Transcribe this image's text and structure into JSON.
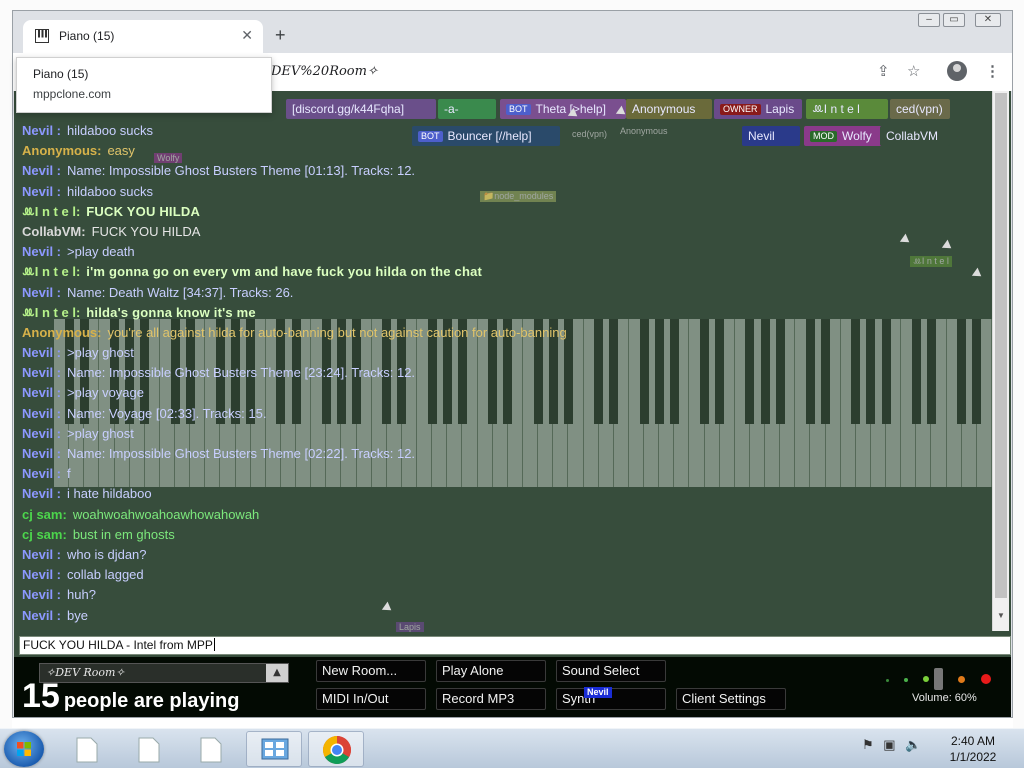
{
  "browser": {
    "tab_title": "Piano (15)",
    "tab_close": "✕",
    "new_tab": "+",
    "url_text": "DEV%20Room✧",
    "tooltip_title": "Piano (15)",
    "tooltip_url": "mppclone.com"
  },
  "userbar": [
    {
      "tag": "",
      "tag_color": "",
      "name": "[discord.gg/k44Fqha]",
      "color": "#6a4f8a"
    },
    {
      "tag": "",
      "tag_color": "",
      "name": "-a-",
      "color": "#3a8a4d"
    },
    {
      "tag": "BOT",
      "tag_color": "#4d5fcc",
      "name": "Theta [>help]",
      "color": "#7a4f8f"
    },
    {
      "tag": "",
      "tag_color": "",
      "name": "Anonymous",
      "color": "#6a6a3a"
    },
    {
      "tag": "OWNER",
      "tag_color": "#8a1a1a",
      "name": "Lapis",
      "color": "#6a4a8a"
    },
    {
      "tag": "",
      "tag_color": "",
      "name": "ꔛI n t e l",
      "color": "#5a8a3a"
    },
    {
      "tag": "",
      "tag_color": "",
      "name": "ced(vpn)",
      "color": "#6a6a4a"
    },
    {
      "tag": "BOT",
      "tag_color": "#4d5fcc",
      "name": "Bouncer [//help]",
      "color": "#2a4a6a"
    },
    {
      "tag": "",
      "tag_color": "",
      "name": "Nevil",
      "color": "#2a3a8a"
    },
    {
      "tag": "MOD",
      "tag_color": "#2a6a2a",
      "name": "Wolfy",
      "color": "#8a3a8a"
    },
    {
      "tag": "",
      "tag_color": "",
      "name": "CollabVM",
      "color": "#374d3c"
    }
  ],
  "chat": [
    {
      "name": "Nevil :",
      "text": "hildaboo sucks",
      "ncolor": "#8c98ff",
      "tcolor": "#c8cfff"
    },
    {
      "name": "Anonymous:",
      "text": "easy",
      "ncolor": "#d7b24a",
      "tcolor": "#e0c46a"
    },
    {
      "name": "Nevil :",
      "text": "Name: Impossible Ghost Busters Theme [01:13]. Tracks: 12.",
      "ncolor": "#8c98ff",
      "tcolor": "#c8cfff"
    },
    {
      "name": "Nevil :",
      "text": "hildaboo sucks",
      "ncolor": "#8c98ff",
      "tcolor": "#c8cfff"
    },
    {
      "name": "ꔛI n t e l:",
      "text": "FUCK YOU HILDA",
      "ncolor": "#b6f28a",
      "tcolor": "#dbffc0"
    },
    {
      "name": "CollabVM:",
      "text": "FUCK YOU HILDA",
      "ncolor": "#d9d9d9",
      "tcolor": "#e6e6e6"
    },
    {
      "name": "Nevil :",
      "text": ">play death",
      "ncolor": "#8c98ff",
      "tcolor": "#c8cfff"
    },
    {
      "name": "ꔛI n t e l:",
      "text": "i'm gonna go on every vm and have fuck you hilda on the chat",
      "ncolor": "#b6f28a",
      "tcolor": "#dbffc0"
    },
    {
      "name": "Nevil :",
      "text": "Name: Death Waltz [34:37]. Tracks: 26.",
      "ncolor": "#8c98ff",
      "tcolor": "#c8cfff"
    },
    {
      "name": "ꔛI n t e l:",
      "text": "hilda's gonna know it's me",
      "ncolor": "#b6f28a",
      "tcolor": "#dbffc0"
    },
    {
      "name": "Anonymous:",
      "text": "you're all against hilda for auto-banning but not against caution for auto-banning",
      "ncolor": "#d7b24a",
      "tcolor": "#e0c46a"
    },
    {
      "name": "Nevil :",
      "text": ">play ghost",
      "ncolor": "#8c98ff",
      "tcolor": "#c8cfff"
    },
    {
      "name": "Nevil :",
      "text": "Name: Impossible Ghost Busters Theme [23:24]. Tracks: 12.",
      "ncolor": "#8c98ff",
      "tcolor": "#c8cfff"
    },
    {
      "name": "Nevil :",
      "text": ">play voyage",
      "ncolor": "#8c98ff",
      "tcolor": "#c8cfff"
    },
    {
      "name": "Nevil :",
      "text": "Name: Voyage [02:33]. Tracks: 15.",
      "ncolor": "#8c98ff",
      "tcolor": "#c8cfff"
    },
    {
      "name": "Nevil :",
      "text": ">play ghost",
      "ncolor": "#8c98ff",
      "tcolor": "#c8cfff"
    },
    {
      "name": "Nevil :",
      "text": "Name: Impossible Ghost Busters Theme [02:22]. Tracks: 12.",
      "ncolor": "#8c98ff",
      "tcolor": "#c8cfff"
    },
    {
      "name": "Nevil :",
      "text": "f",
      "ncolor": "#8c98ff",
      "tcolor": "#c8cfff"
    },
    {
      "name": "Nevil :",
      "text": "i hate hildaboo",
      "ncolor": "#8c98ff",
      "tcolor": "#c8cfff"
    },
    {
      "name": "cj sam:",
      "text": "woahwoahwoahoawhowahowah",
      "ncolor": "#4cd64c",
      "tcolor": "#7ce87c"
    },
    {
      "name": "cj sam:",
      "text": "bust in em ghosts",
      "ncolor": "#4cd64c",
      "tcolor": "#7ce87c"
    },
    {
      "name": "Nevil :",
      "text": "who is djdan?",
      "ncolor": "#8c98ff",
      "tcolor": "#c8cfff"
    },
    {
      "name": "Nevil :",
      "text": "collab lagged",
      "ncolor": "#8c98ff",
      "tcolor": "#c8cfff"
    },
    {
      "name": "Nevil :",
      "text": "huh?",
      "ncolor": "#8c98ff",
      "tcolor": "#c8cfff"
    },
    {
      "name": "Nevil :",
      "text": "bye",
      "ncolor": "#8c98ff",
      "tcolor": "#c8cfff"
    }
  ],
  "input_value": "FUCK YOU HILDA - Intel from MPP",
  "room": {
    "name": "✧DEV Room✧",
    "arrow": "▲",
    "count": "15",
    "count_label": "people are playing"
  },
  "buttons": {
    "new_room": "New Room...",
    "play_alone": "Play Alone",
    "sound_select": "Sound Select",
    "midi": "MIDI In/Out",
    "record": "Record MP3",
    "synth": "Synth",
    "client_settings": "Client Settings"
  },
  "volume": {
    "label": "Volume: 60%",
    "level": 0.6
  },
  "cursor_tag": "Nevil",
  "cursor_labels": {
    "lapis": "Lapis",
    "node_modules": "📁node_modules",
    "ced": "ced(vpn)",
    "anon": "Anonymous",
    "intel": "ꔛI n t e l",
    "wolfy": "Wolfy"
  },
  "taskbar": {
    "time": "2:40 AM",
    "date": "1/1/2022"
  },
  "colors": {
    "page_bg": "#374d3c",
    "bottom_bg": "#030a03",
    "nevil_tag": "#1a2dd6"
  }
}
